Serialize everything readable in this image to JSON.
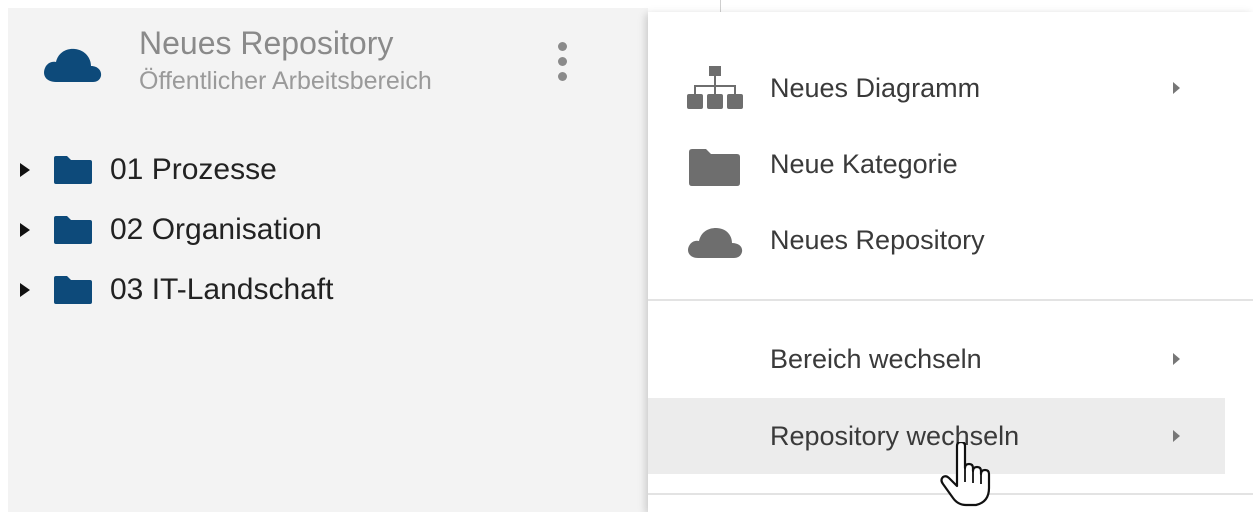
{
  "repository": {
    "title": "Neues Repository",
    "subtitle": "Öffentlicher Arbeitsbereich",
    "icon": "cloud-icon",
    "icon_color": "#0d4a7a"
  },
  "tree": {
    "items": [
      {
        "label": "01 Prozesse",
        "icon": "folder-icon"
      },
      {
        "label": "02 Organisation",
        "icon": "folder-icon"
      },
      {
        "label": "03 IT-Landschaft",
        "icon": "folder-icon"
      }
    ]
  },
  "menu": {
    "items": [
      {
        "label": "Neues Diagramm",
        "icon": "sitemap-icon",
        "has_submenu": true
      },
      {
        "label": "Neue Kategorie",
        "icon": "folder-icon",
        "has_submenu": false
      },
      {
        "label": "Neues Repository",
        "icon": "cloud-icon",
        "has_submenu": false
      },
      {
        "label": "Bereich wechseln",
        "icon": "",
        "has_submenu": true
      },
      {
        "label": "Repository wechseln",
        "icon": "",
        "has_submenu": true,
        "hovered": true
      }
    ]
  },
  "colors": {
    "folder": "#0d4a7a",
    "menu_icon": "#6e6e6e",
    "hover_bg": "#ececec",
    "sidebar_bg": "#f3f3f3"
  }
}
